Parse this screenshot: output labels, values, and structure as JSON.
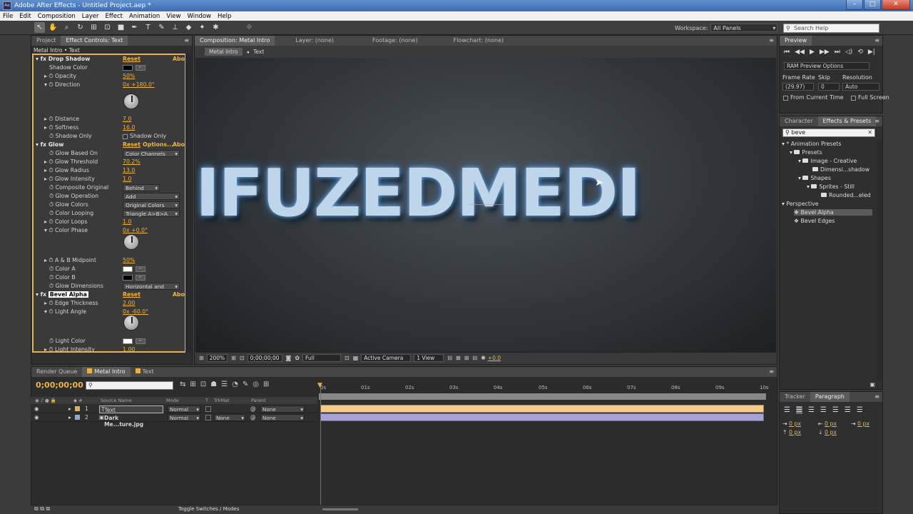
{
  "title": "Adobe After Effects - Untitled Project.aep *",
  "menu": [
    "File",
    "Edit",
    "Composition",
    "Layer",
    "Effect",
    "Animation",
    "View",
    "Window",
    "Help"
  ],
  "workspace": {
    "label": "Workspace:",
    "value": "All Panels"
  },
  "search_help": "Search Help",
  "left_tabs": [
    "Project",
    "Effect Controls: Text"
  ],
  "ec_path": "Metal Intro • Text",
  "drop_shadow": {
    "name": "Drop Shadow",
    "reset": "Reset",
    "about": "Abo",
    "shadow_color": "Shadow Color",
    "opacity_l": "Opacity",
    "opacity_v": "50%",
    "direction_l": "Direction",
    "direction_v": "0x +180.0°",
    "distance_l": "Distance",
    "distance_v": "7.0",
    "softness_l": "Softness",
    "softness_v": "16.0",
    "shadow_only_l": "Shadow Only",
    "shadow_only_v": "Shadow Only"
  },
  "glow": {
    "name": "Glow",
    "reset": "Reset",
    "options": "Options...",
    "about": "Abo",
    "based_on_l": "Glow Based On",
    "based_on_v": "Color Channels",
    "threshold_l": "Glow Threshold",
    "threshold_v": "70.2%",
    "radius_l": "Glow Radius",
    "radius_v": "13.0",
    "intensity_l": "Glow Intensity",
    "intensity_v": "1.0",
    "composite_l": "Composite Original",
    "composite_v": "Behind",
    "operation_l": "Glow Operation",
    "operation_v": "Add",
    "colors_l": "Glow Colors",
    "colors_v": "Original Colors",
    "looping_l": "Color Looping",
    "looping_v": "Triangle A>B>A",
    "loops_l": "Color Loops",
    "loops_v": "1.0",
    "phase_l": "Color Phase",
    "phase_v": "0x +0.0°",
    "midpoint_l": "A & B Midpoint",
    "midpoint_v": "50%",
    "color_a": "Color A",
    "color_b": "Color B",
    "dimensions_l": "Glow Dimensions",
    "dimensions_v": "Horizontal and"
  },
  "bevel": {
    "name": "Bevel Alpha",
    "reset": "Reset",
    "about": "Abo",
    "edge_l": "Edge Thickness",
    "edge_v": "2.00",
    "angle_l": "Light Angle",
    "angle_v": "0x -60.0°",
    "color_l": "Light Color",
    "intensity_l": "Light Intensity",
    "intensity_v": "1.00"
  },
  "comp_tabs": [
    "Composition: Metal Intro",
    "Layer: (none)",
    "Footage: (none)",
    "Flowchart: (none)"
  ],
  "comp_breadcrumb": [
    "Metal Intro",
    "Text"
  ],
  "canvas_text": "IFUZEDMEDI",
  "viewer_bar": {
    "zoom": "200%",
    "timecode": "0;00;00;00",
    "resolution": "Full",
    "camera": "Active Camera",
    "views": "1 View",
    "exposure": "+0.0"
  },
  "tl_tabs": [
    "Render Queue",
    "Metal Intro",
    "Text"
  ],
  "tl_time": "0;00;00;00",
  "tl_search": "",
  "col_heads": {
    "source": "Source Name",
    "mode": "Mode",
    "t": "T",
    "trkmat": "TrkMat",
    "parent": "Parent"
  },
  "layers": [
    {
      "num": "1",
      "name": "Text",
      "mode": "Normal",
      "trkmat": "",
      "parent": "None"
    },
    {
      "num": "2",
      "name": "Dark Me...ture.jpg",
      "mode": "Normal",
      "trkmat": "None",
      "parent": "None"
    }
  ],
  "ruler": [
    "0s",
    "01s",
    "02s",
    "03s",
    "04s",
    "05s",
    "06s",
    "07s",
    "08s",
    "09s",
    "10s"
  ],
  "toggle_label": "Toggle Switches / Modes",
  "preview": {
    "tab": "Preview",
    "ram": "RAM Preview Options",
    "fr_l": "Frame Rate",
    "fr_v": "(29.97)",
    "skip_l": "Skip",
    "skip_v": "0",
    "res_l": "Resolution",
    "res_v": "Auto",
    "from_current": "From Current Time",
    "full_screen": "Full Screen"
  },
  "fx_tabs": [
    "Character",
    "Effects & Presets"
  ],
  "fx_search": "beve",
  "fx_tree": [
    "Animation Presets",
    "Presets",
    "Image - Creative",
    "Dimensi...shadow",
    "Shapes",
    "Sprites - Still",
    "Rounded...eled",
    "Perspective",
    "Bevel Alpha",
    "Bevel Edges"
  ],
  "para_tabs": [
    "Tracker",
    "Paragraph"
  ],
  "para_vals": [
    "0 px",
    "0 px",
    "0 px",
    "0 px",
    "0 px"
  ],
  "colors": {
    "accent": "#e5b14a",
    "value": "#f0b440",
    "layer1": "#f5cb8a",
    "layer2": "#a8a2d8",
    "playhead": "#e04a3a"
  }
}
